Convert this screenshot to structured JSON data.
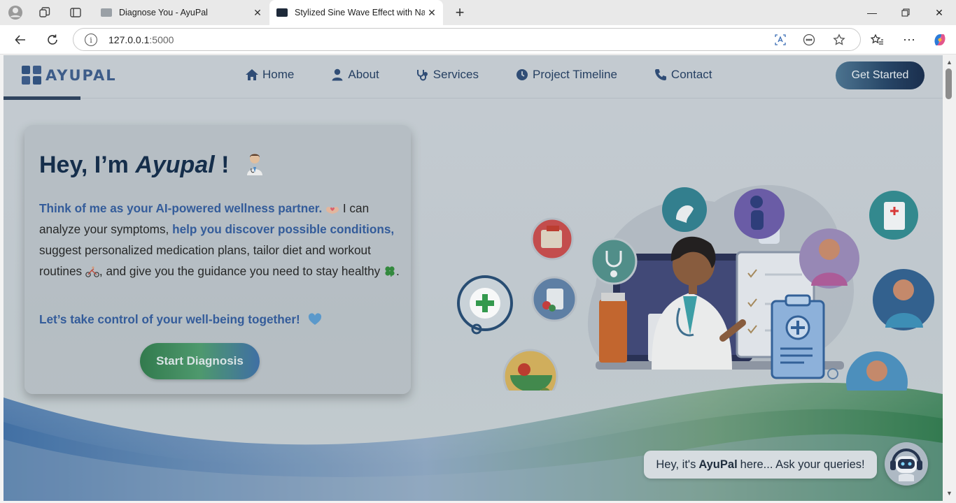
{
  "browser": {
    "tabs": [
      {
        "title": "Diagnose You - AyuPal",
        "active": false
      },
      {
        "title": "Stylized Sine Wave Effect with Na",
        "active": true
      }
    ],
    "url_host": "127.0.0.1",
    "url_port": ":5000",
    "icons": [
      "profile-icon",
      "workspaces-icon",
      "tab-actions-icon",
      "back-icon",
      "refresh-icon",
      "info-icon",
      "translate-icon",
      "read-aloud-icon",
      "favorite-star-icon",
      "favorites-icon",
      "more-icon",
      "copilot-icon"
    ]
  },
  "navbar": {
    "logo_text": "AYUPAL",
    "items": [
      {
        "label": "Home",
        "icon": "home-icon"
      },
      {
        "label": "About",
        "icon": "user-icon"
      },
      {
        "label": "Services",
        "icon": "stethoscope-icon"
      },
      {
        "label": "Project Timeline",
        "icon": "clock-icon"
      },
      {
        "label": "Contact",
        "icon": "phone-icon"
      }
    ],
    "cta": "Get Started"
  },
  "hero": {
    "title_prefix": "Hey, I’m ",
    "title_name": "Ayupal",
    "title_suffix": " !",
    "p1": "Think of me as your AI-powered wellness partner.",
    "p2": " I can analyze your symptoms, ",
    "p3": "help you discover possible conditions,",
    "p4": " suggest personalized medication plans, tailor diet and workout routines ",
    "p5": ", and give you the guidance you need to stay healthy ",
    "p6": ".",
    "tagline": "Let’s take control of your well-being together!",
    "button": "Start Diagnosis"
  },
  "chat": {
    "prefix": "Hey, it's",
    "name": "AyuPal",
    "suffix": "here... Ask your queries!"
  },
  "colors": {
    "navy": "#0f2948",
    "accent_blue": "#305a9c",
    "green": "#2e7a4a"
  }
}
